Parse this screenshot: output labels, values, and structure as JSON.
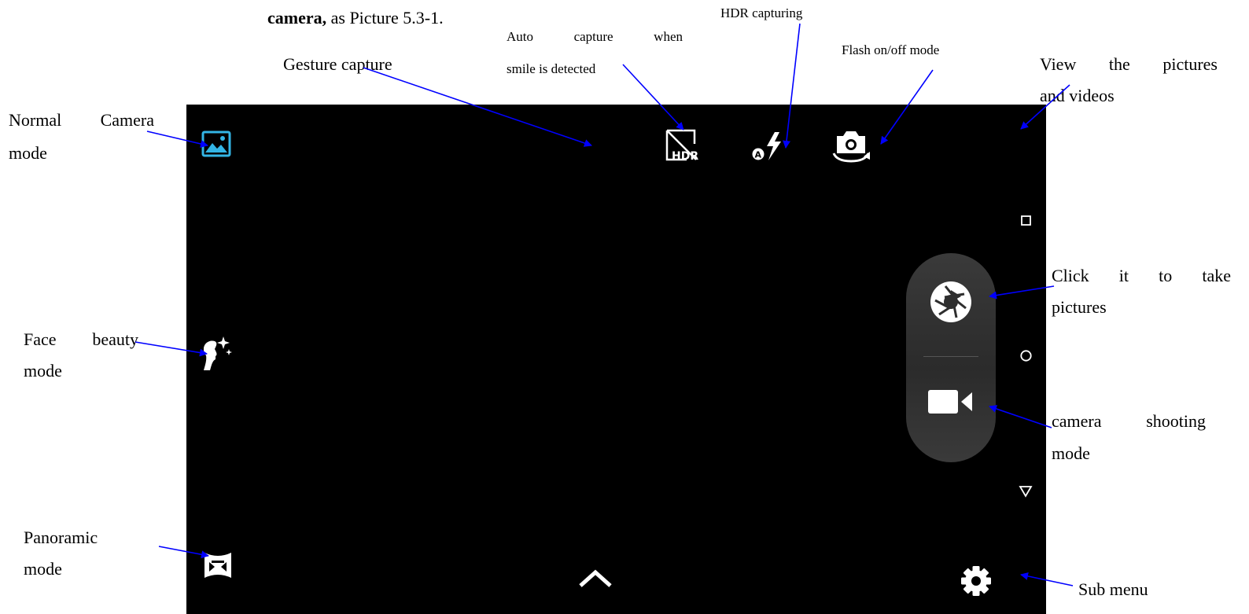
{
  "header": {
    "intro_bold": "camera,",
    "intro_rest": " as Picture 5.3-1."
  },
  "labels": {
    "hdr_capturing": "HDR capturing",
    "auto_capture_line1": "Auto capture when",
    "auto_capture_line2": "smile is detected",
    "flash_mode": "Flash on/off mode",
    "gesture_capture": "Gesture capture",
    "view_line1": "View the pictures",
    "view_line2": "and videos",
    "normal_camera_line1": "Normal Camera",
    "normal_camera_line2": "mode",
    "face_beauty_line1": "Face beauty",
    "face_beauty_line2": "mode",
    "panoramic_line1": "Panoramic",
    "panoramic_line2": "mode",
    "take_pictures_line1": "Click it to take",
    "take_pictures_line2": "pictures",
    "video_line1": "camera shooting",
    "video_line2": "mode",
    "sub_menu": "Sub menu"
  },
  "screen": {
    "hdr_icon_text": "HDR",
    "flash_auto_badge": "A",
    "icons": [
      "normal-camera-mode-icon",
      "face-beauty-mode-icon",
      "panoramic-mode-icon",
      "hdr-icon",
      "flash-auto-icon",
      "switch-camera-icon",
      "shutter-icon",
      "video-record-icon",
      "expand-chevron-icon",
      "settings-gear-icon",
      "nav-recent-icon",
      "nav-home-icon",
      "nav-back-icon"
    ],
    "colors": {
      "background": "#000000",
      "active_mode_icon": "#33B5E5",
      "icon": "#FFFFFF",
      "capsule": "#333333",
      "arrow": "#0000FF"
    }
  }
}
